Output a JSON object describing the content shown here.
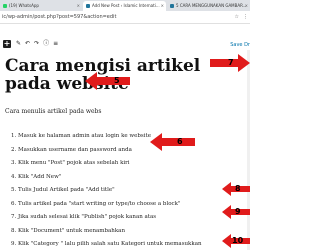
{
  "browser": {
    "tabs": [
      {
        "label": "(19) WhatsApp",
        "icon_color": "#25d366",
        "active": false
      },
      {
        "label": "Add New Post ‹ Islamic Internati...",
        "icon_color": "#21759b",
        "active": true
      },
      {
        "label": "5 CARA MENGGUNAKAN GAMBAR...",
        "icon_color": "#21759b",
        "active": false
      }
    ],
    "close_glyph": "×",
    "url": "ic/wp-admin/post.php?post=597&action=edit"
  },
  "editor": {
    "toolbar_plus": "+",
    "toolbar_icons": [
      "✎",
      "↶",
      "↷",
      "ⓘ",
      "≡"
    ],
    "save_draft": "Save Dr",
    "title": "Cara mengisi artikel pada website",
    "intro": "Cara menulis artikel pada webs",
    "steps": [
      {
        "num": "1.",
        "text": "Masuk ke halaman admin atau login ke website"
      },
      {
        "num": "2.",
        "text": "Masukkan username dan password anda"
      },
      {
        "num": "3.",
        "text": "Klik menu \"Post\" pojok atas sebelah kiri"
      },
      {
        "num": "4.",
        "text": "Klik \"Add New\""
      },
      {
        "num": "5.",
        "text": "Tulis Judul Artikel pada \"Add title\""
      },
      {
        "num": "6.",
        "text": "Tulis artikel pada \"start writing or type/to choose a block\""
      },
      {
        "num": "7.",
        "text": "Jika sudah selesai klik \"Publish\" pojok kanan atas"
      },
      {
        "num": "8.",
        "text": "Klik \"Document\" untuk menambahkan"
      },
      {
        "num": "9.",
        "text": "Klik \"Category \" lalu pilih salah satu Kategori untuk memasukkan"
      }
    ]
  },
  "annotations": {
    "color": "#e01b1b",
    "labels": [
      "5",
      "6",
      "7",
      "8",
      "9",
      "10"
    ]
  }
}
